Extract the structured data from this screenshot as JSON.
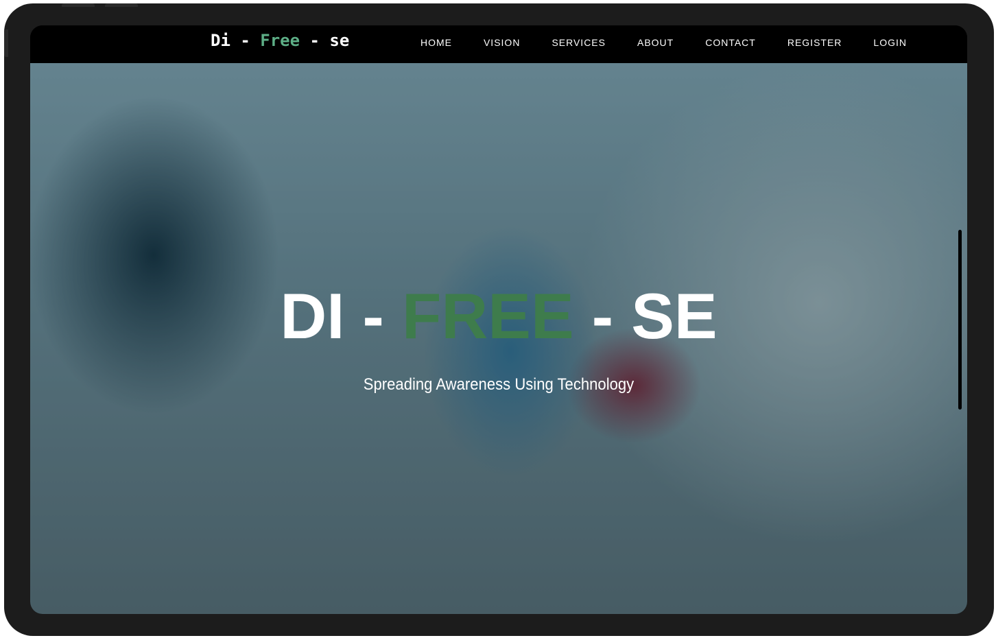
{
  "logo": {
    "part1": "Di - ",
    "part2": "Free",
    "part3": " - se",
    "accent": "#5dae86"
  },
  "nav": {
    "items": [
      "HOME",
      "VISION",
      "SERVICES",
      "ABOUT",
      "CONTACT",
      "REGISTER",
      "LOGIN"
    ]
  },
  "hero": {
    "title1": "DI - ",
    "title2": "FREE",
    "title3": " - SE",
    "accent": "#3e7c4c",
    "subtitle": "Spreading Awareness Using Technology"
  }
}
